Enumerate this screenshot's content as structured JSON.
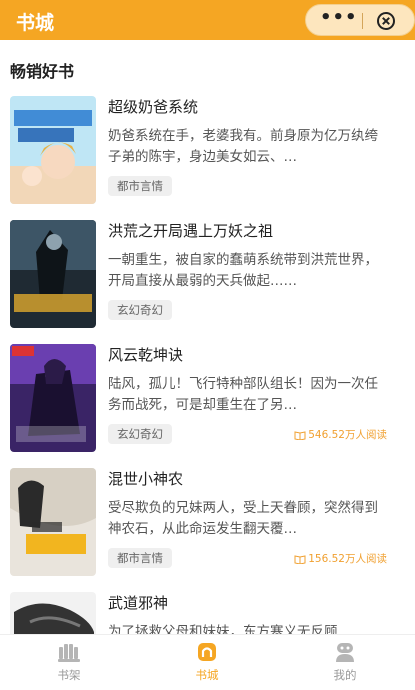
{
  "header": {
    "title": "书城"
  },
  "capsule": {
    "more_label": "•••"
  },
  "section": {
    "title": "畅销好书"
  },
  "books": [
    {
      "title": "超级奶爸系统",
      "desc": "奶爸系统在手，老婆我有。前身原为亿万纨绔子弟的陈宇，身边美女如云、…",
      "tag": "都市言情",
      "reads": ""
    },
    {
      "title": "洪荒之开局遇上万妖之祖",
      "desc": "一朝重生，被自家的蠢萌系统带到洪荒世界，开局直接从最弱的天兵做起……",
      "tag": "玄幻奇幻",
      "reads": ""
    },
    {
      "title": "风云乾坤诀",
      "desc": "陆风，孤儿！飞行特种部队组长！因为一次任务而战死，可是却重生在了另…",
      "tag": "玄幻奇幻",
      "reads": "546.52万人阅读"
    },
    {
      "title": "混世小神农",
      "desc": "受尽欺负的兄妹两人，受上天眷顾，突然得到神农石，从此命运发生翻天覆…",
      "tag": "都市言情",
      "reads": "156.52万人阅读"
    },
    {
      "title": "武道邪神",
      "desc": "为了拯救父母和妹妹，东方寒义无反顾…",
      "tag": "",
      "reads": ""
    }
  ],
  "tabs": [
    {
      "label": "书架",
      "icon": "bookshelf-icon"
    },
    {
      "label": "书城",
      "icon": "home-icon"
    },
    {
      "label": "我的",
      "icon": "profile-icon"
    }
  ],
  "colors": {
    "accent": "#f5a623",
    "tag_bg": "#efefef"
  }
}
